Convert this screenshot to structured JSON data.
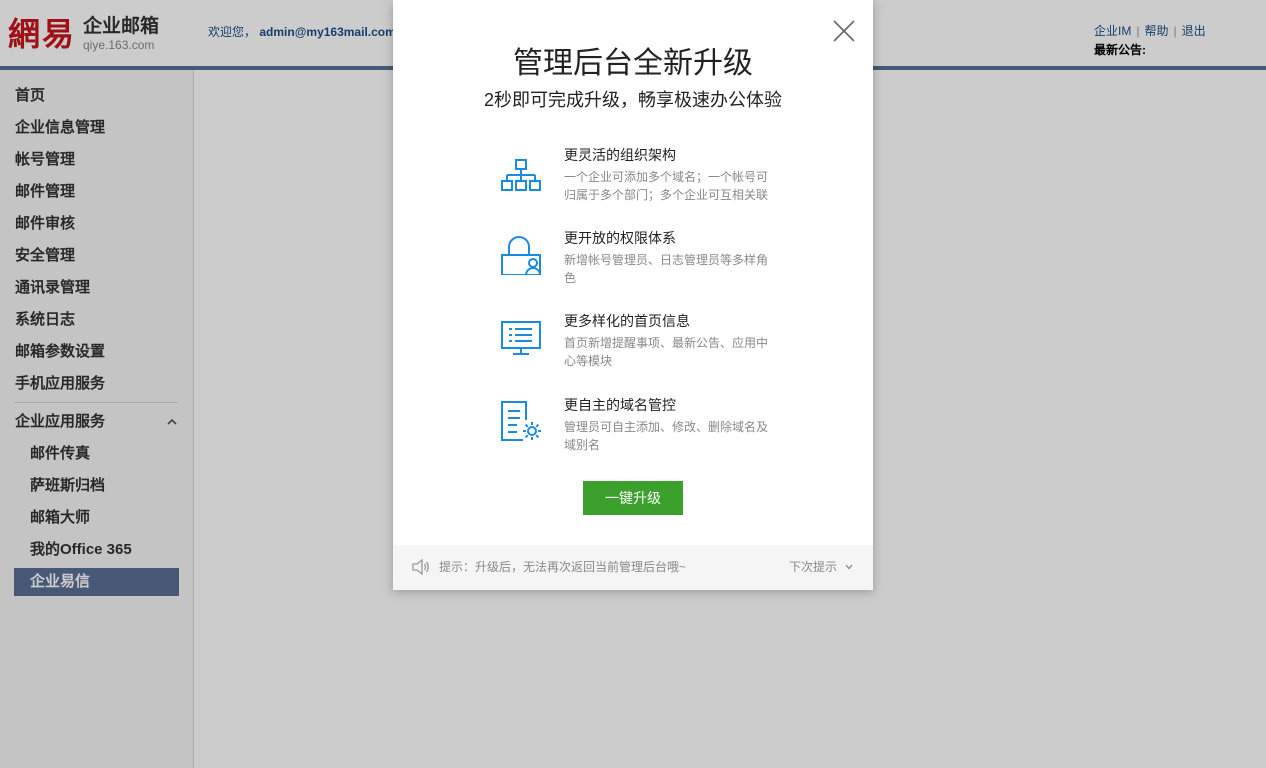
{
  "header": {
    "logo_mark": "網易",
    "logo_name": "企业邮箱",
    "logo_domain": "qiye.163.com",
    "welcome_prefix": "欢迎您，",
    "welcome_user": "admin@my163mail.com",
    "links": {
      "im": "企业IM",
      "help": "帮助",
      "logout": "退出"
    },
    "notice_label": "最新公告:"
  },
  "sidebar": {
    "items": [
      "首页",
      "企业信息管理",
      "帐号管理",
      "邮件管理",
      "邮件审核",
      "安全管理",
      "通讯录管理",
      "系统日志",
      "邮箱参数设置",
      "手机应用服务"
    ],
    "group": {
      "label": "企业应用服务",
      "items": [
        "邮件传真",
        "萨班斯归档",
        "邮箱大师",
        "我的Office 365"
      ],
      "active": "企业易信"
    }
  },
  "modal": {
    "title": "管理后台全新升级",
    "subtitle": "2秒即可完成升级，畅享极速办公体验",
    "features": [
      {
        "icon": "org-structure-icon",
        "title": "更灵活的组织架构",
        "desc": "一个企业可添加多个域名；一个帐号可归属于多个部门；多个企业可互相关联"
      },
      {
        "icon": "permission-icon",
        "title": "更开放的权限体系",
        "desc": "新增帐号管理员、日志管理员等多样角色"
      },
      {
        "icon": "monitor-icon",
        "title": "更多样化的首页信息",
        "desc": "首页新增提醒事项、最新公告、应用中心等模块"
      },
      {
        "icon": "domain-settings-icon",
        "title": "更自主的域名管控",
        "desc": "管理员可自主添加、修改、删除域名及域别名"
      }
    ],
    "button": "一键升级",
    "footer": {
      "hint": "提示：升级后，无法再次返回当前管理后台哦~",
      "next": "下次提示"
    }
  },
  "colors": {
    "accent": "#5a6f95",
    "brand": "#c8161d",
    "button": "#3ca12c",
    "icon": "#1a8be0"
  }
}
